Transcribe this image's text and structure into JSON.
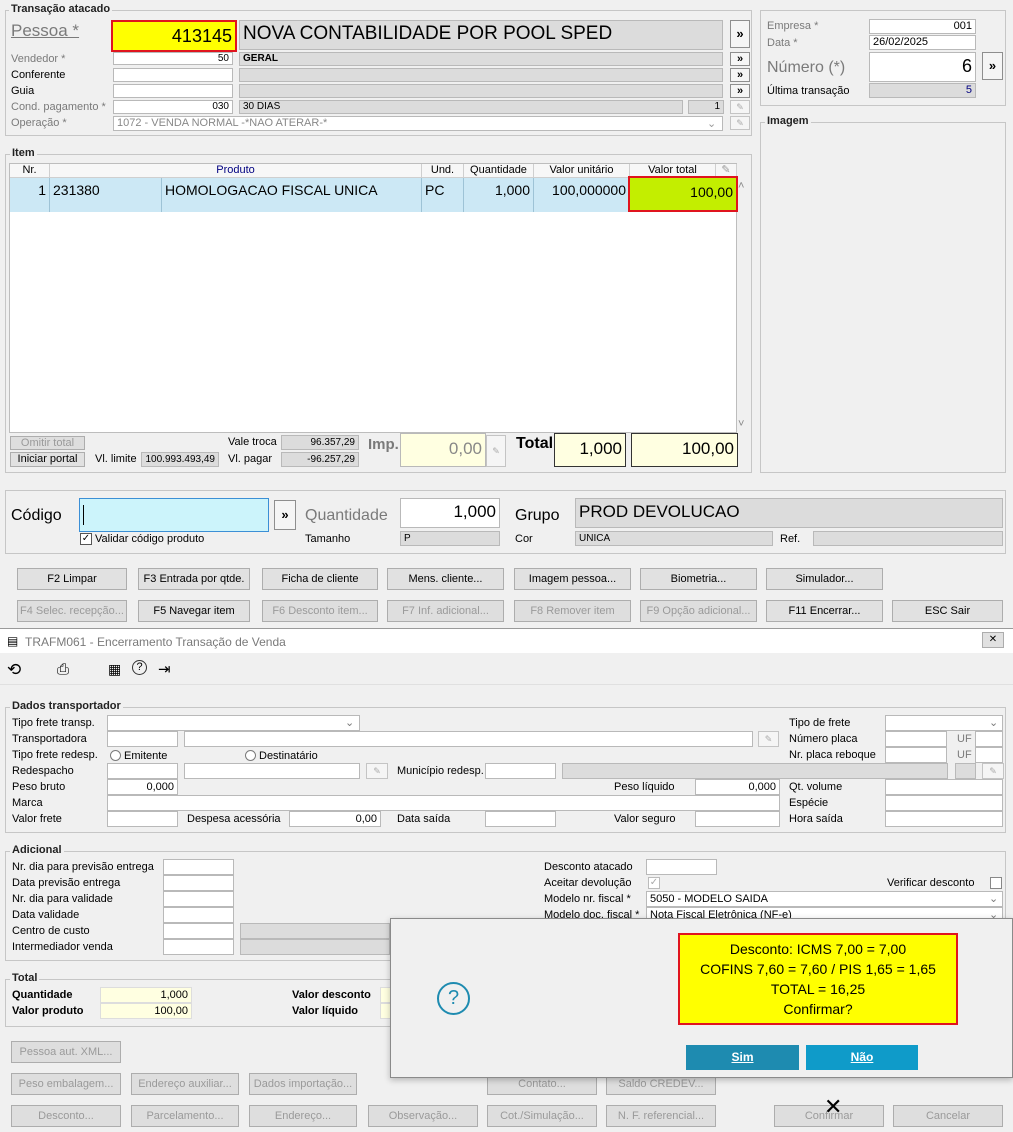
{
  "transacao": {
    "group_title": "Transação atacado",
    "pessoa_label": "Pessoa *",
    "pessoa_code": "413145",
    "pessoa_name": "NOVA CONTABILIDADE POR POOL SPED",
    "vendedor_label": "Vendedor *",
    "vendedor_code": "50",
    "vendedor_name": "GERAL",
    "conferente_label": "Conferente",
    "guia_label": "Guia",
    "cond_label": "Cond. pagamento *",
    "cond_code": "030",
    "cond_name": "30 DIAS",
    "cond_parcelas": "1",
    "operacao_label": "Operação *",
    "operacao_value": "1072 - VENDA NORMAL -*NAO ATERAR-*"
  },
  "empresa": {
    "empresa_label": "Empresa *",
    "empresa_value": "001",
    "data_label": "Data *",
    "data_value": "26/02/2025",
    "numero_label": "Número (*)",
    "numero_value": "6",
    "ultima_label": "Última transação",
    "ultima_value": "5",
    "imagem_title": "Imagem"
  },
  "item": {
    "group_title": "Item",
    "headers": [
      "Nr.",
      "Produto",
      "Und.",
      "Quantidade",
      "Valor unitário",
      "Valor total"
    ],
    "rows": [
      {
        "nr": "1",
        "codigo": "231380",
        "produto": "HOMOLOGACAO FISCAL UNICA",
        "und": "PC",
        "qtd": "1,000",
        "unit": "100,000000",
        "total": "100,00"
      }
    ],
    "omitir_total": "Omitir total",
    "iniciar_portal": "Iniciar portal",
    "vl_limite_label": "Vl. limite",
    "vl_limite_value": "100.993.493,49",
    "vale_troca_label": "Vale troca",
    "vale_troca_value": "96.357,29",
    "vl_pagar_label": "Vl. pagar",
    "vl_pagar_value": "-96.257,29",
    "imp_label": "Imp.",
    "imp_value": "0,00",
    "total_label": "Total",
    "total_qtd": "1,000",
    "total_valor": "100,00"
  },
  "codigo_bar": {
    "codigo_label": "Código",
    "validar_label": "Validar código produto",
    "quantidade_label": "Quantidade",
    "quantidade_value": "1,000",
    "tamanho_label": "Tamanho",
    "tamanho_value": "P",
    "grupo_label": "Grupo",
    "grupo_value": "PROD DEVOLUCAO",
    "cor_label": "Cor",
    "cor_value": "UNICA",
    "ref_label": "Ref."
  },
  "fkeys": {
    "row1": [
      "F2 Limpar",
      "F3 Entrada por qtde.",
      "Ficha de cliente",
      "Mens. cliente...",
      "Imagem pessoa...",
      "Biometria...",
      "Simulador..."
    ],
    "row2": [
      "F4 Selec. recepção...",
      "F5 Navegar item",
      "F6 Desconto item...",
      "F7 Inf. adicional...",
      "F8 Remover item",
      "F9 Opção adicional...",
      "F11 Encerrar...",
      "ESC Sair"
    ]
  },
  "encerramento": {
    "window_title": "TRAFM061 - Encerramento Transação de Venda",
    "close_glyph": "✕",
    "transportador_title": "Dados transportador",
    "tipo_frete_transp": "Tipo frete transp.",
    "transportadora": "Transportadora",
    "tipo_frete_redesp": "Tipo frete redesp.",
    "emitente": "Emitente",
    "destinatario": "Destinatário",
    "redespacho": "Redespacho",
    "municipio_redesp": "Município redesp.",
    "peso_bruto": "Peso bruto",
    "peso_bruto_value": "0,000",
    "peso_liquido": "Peso líquido",
    "peso_liquido_value": "0,000",
    "marca": "Marca",
    "valor_frete": "Valor frete",
    "despesa_acessoria": "Despesa acessória",
    "despesa_value": "0,00",
    "data_saida": "Data saída",
    "valor_seguro": "Valor seguro",
    "tipo_de_frete": "Tipo de frete",
    "numero_placa": "Número placa",
    "nr_placa_reboque": "Nr. placa reboque",
    "uf": "UF",
    "qt_volume": "Qt. volume",
    "especie": "Espécie",
    "hora_saida": "Hora saída",
    "adicional_title": "Adicional",
    "nr_dia_previsao": "Nr. dia para previsão entrega",
    "data_previsao": "Data previsão entrega",
    "nr_dia_validade": "Nr. dia para validade",
    "data_validade": "Data validade",
    "centro_custo": "Centro de custo",
    "intermediador": "Intermediador venda",
    "desconto_atacado": "Desconto atacado",
    "aceitar_devolucao": "Aceitar devolução",
    "verificar_desconto": "Verificar desconto",
    "modelo_nr_fiscal": "Modelo nr. fiscal *",
    "modelo_nr_fiscal_value": "5050 - MODELO SAIDA",
    "modelo_doc_fiscal": "Modelo doc. fiscal *",
    "modelo_doc_fiscal_value": "Nota Fiscal Eletrônica (NF-e)",
    "total_title": "Total",
    "quantidade": "Quantidade",
    "quantidade_value": "1,000",
    "valor_produto": "Valor produto",
    "valor_produto_value": "100,00",
    "valor_desconto": "Valor desconto",
    "valor_liquido": "Valor líquido",
    "buttons_row1": [
      "Pessoa aut. XML..."
    ],
    "buttons_row2": [
      "Peso embalagem...",
      "Endereço auxiliar...",
      "Dados importação...",
      "Contato...",
      "Saldo CREDEV..."
    ],
    "buttons_row3": [
      "Desconto...",
      "Parcelamento...",
      "Endereço...",
      "Observação...",
      "Cot./Simulação...",
      "N. F. referencial...",
      "Confirmar",
      "Cancelar"
    ]
  },
  "dialog": {
    "lines": [
      "Desconto: ICMS 7,00 = 7,00",
      "COFINS 7,60 = 7,60 / PIS 1,65 = 1,65",
      "TOTAL = 16,25",
      "Confirmar?"
    ],
    "sim": "Sim",
    "nao": "Não",
    "question_glyph": "?"
  },
  "colors": {
    "yellow_highlight": "#ffff00",
    "green_total": "#c3ee00",
    "red_outline": "#e0141e",
    "selected_row": "#cce8f5",
    "dialog_button": "#1e8bb0"
  }
}
